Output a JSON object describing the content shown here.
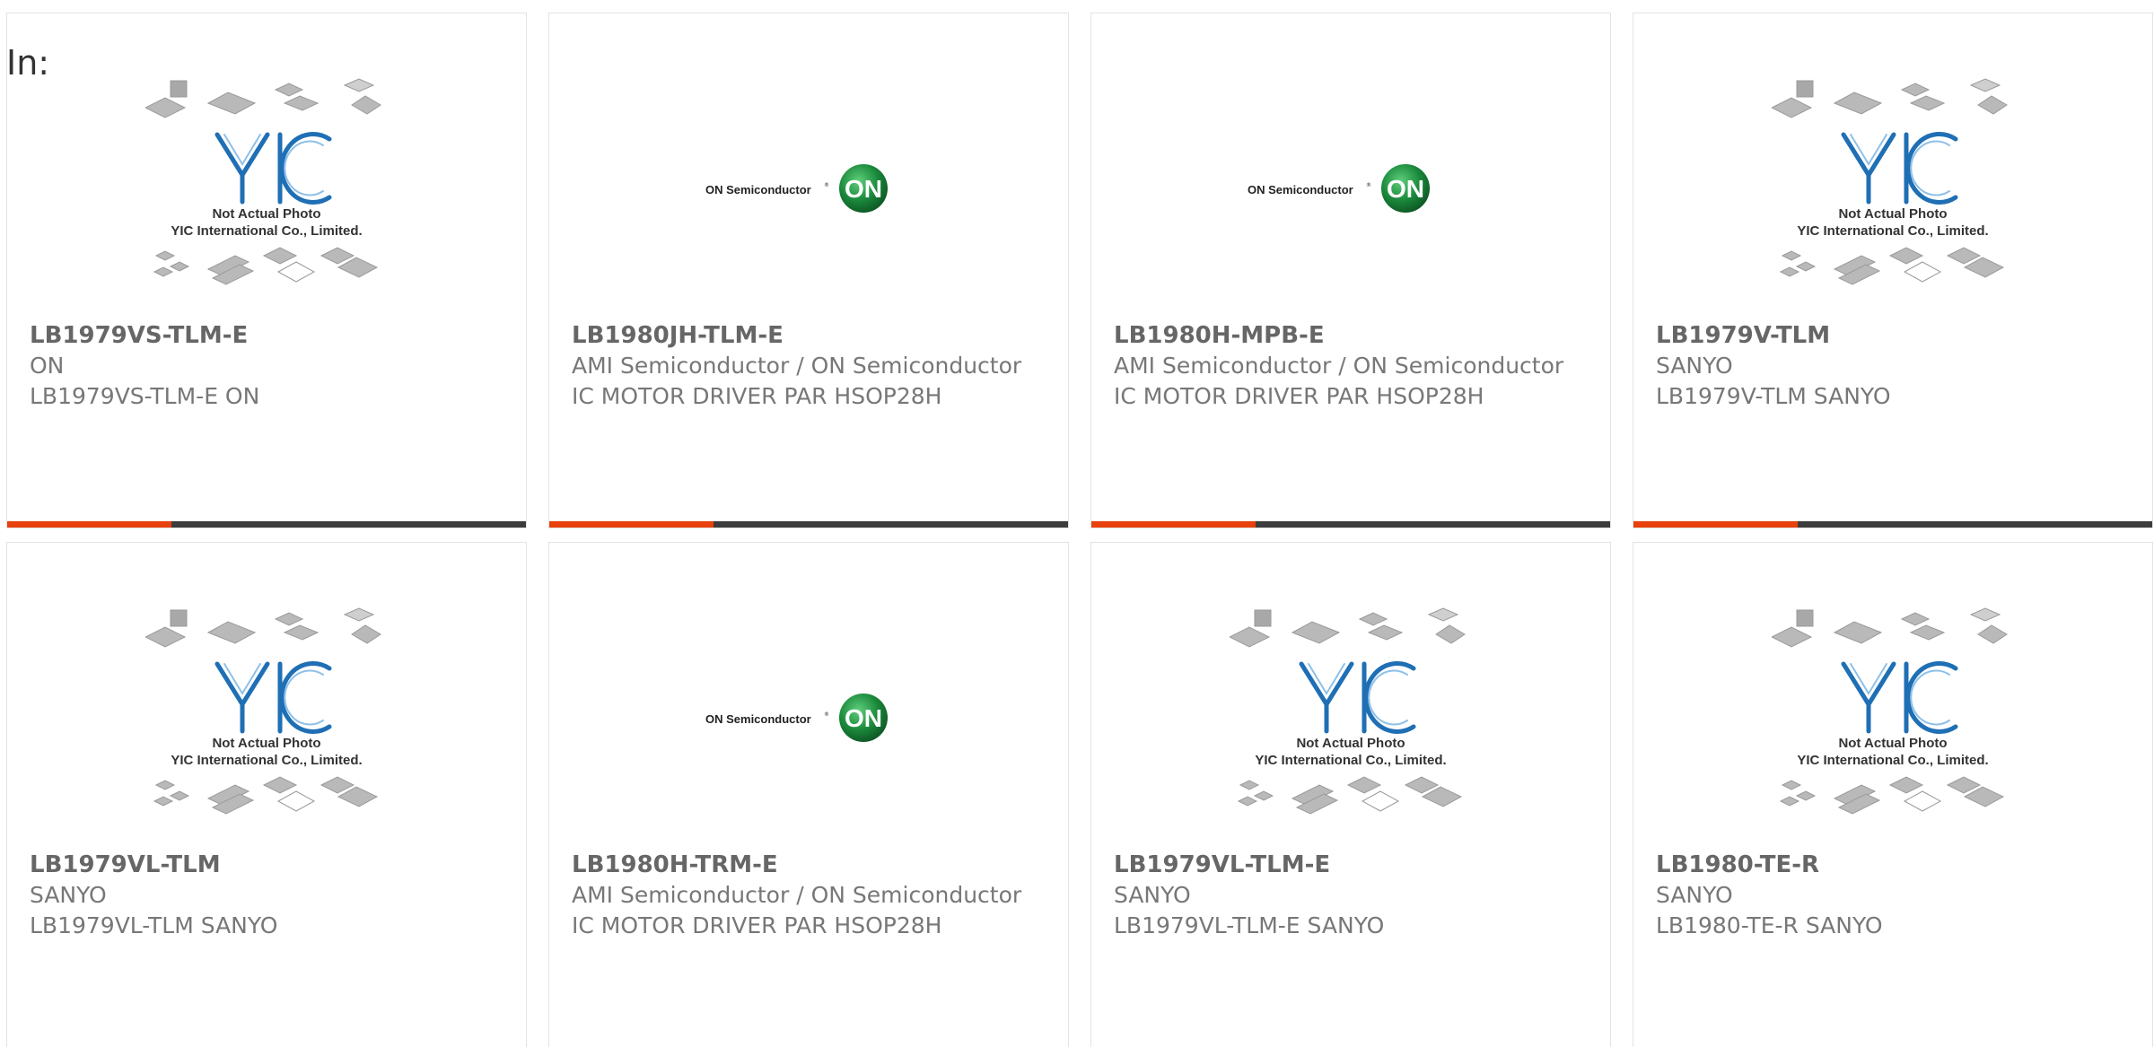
{
  "header": {
    "in_label": "In:"
  },
  "colors": {
    "accent": "#e8410c",
    "bar": "#3c3c3c",
    "on_green": "#1b8a3c",
    "yic_blue": "#1f6fb5"
  },
  "photo": {
    "yic_caption_line1": "Not Actual Photo",
    "yic_caption_line2": "YIC International Co., Limited.",
    "on_logo_text": "ON Semiconductor",
    "on_logo_mark": "ON"
  },
  "products": [
    {
      "part_number": "LB1979VS-TLM-E",
      "manufacturer": "ON",
      "description": "LB1979VS-TLM-E ON",
      "image": "yic-placeholder",
      "has_bar": true
    },
    {
      "part_number": "LB1980JH-TLM-E",
      "manufacturer": "AMI Semiconductor / ON Semiconductor",
      "description": "IC MOTOR DRIVER PAR HSOP28H",
      "image": "on-semiconductor-logo",
      "has_bar": true
    },
    {
      "part_number": "LB1980H-MPB-E",
      "manufacturer": "AMI Semiconductor / ON Semiconductor",
      "description": "IC MOTOR DRIVER PAR HSOP28H",
      "image": "on-semiconductor-logo",
      "has_bar": true
    },
    {
      "part_number": "LB1979V-TLM",
      "manufacturer": "SANYO",
      "description": "LB1979V-TLM SANYO",
      "image": "yic-placeholder",
      "has_bar": true
    },
    {
      "part_number": "LB1979VL-TLM",
      "manufacturer": "SANYO",
      "description": "LB1979VL-TLM SANYO",
      "image": "yic-placeholder",
      "has_bar": false
    },
    {
      "part_number": "LB1980H-TRM-E",
      "manufacturer": "AMI Semiconductor / ON Semiconductor",
      "description": "IC MOTOR DRIVER PAR HSOP28H",
      "image": "on-semiconductor-logo",
      "has_bar": false
    },
    {
      "part_number": "LB1979VL-TLM-E",
      "manufacturer": "SANYO",
      "description": "LB1979VL-TLM-E SANYO",
      "image": "yic-placeholder",
      "has_bar": false
    },
    {
      "part_number": "LB1980-TE-R",
      "manufacturer": "SANYO",
      "description": "LB1980-TE-R SANYO",
      "image": "yic-placeholder",
      "has_bar": false
    }
  ]
}
